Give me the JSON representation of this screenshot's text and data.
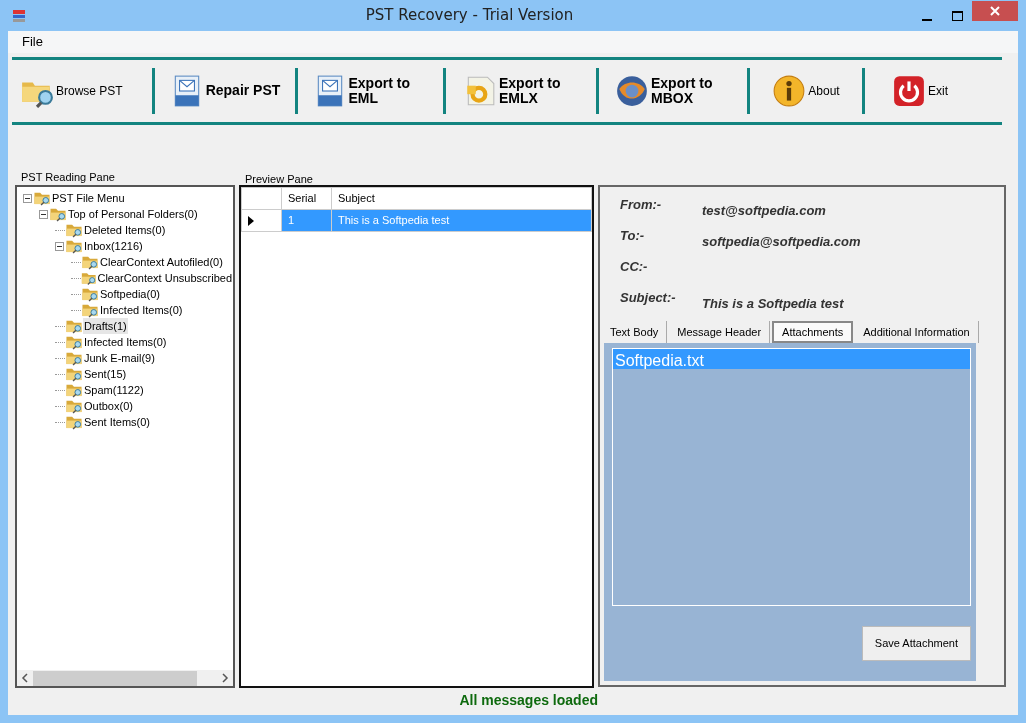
{
  "window": {
    "title": "PST Recovery - Trial Version"
  },
  "menu": [
    "File"
  ],
  "toolbar": [
    {
      "label": "Browse PST",
      "kind": "browse",
      "bold": false
    },
    {
      "label": "Repair PST",
      "kind": "eml",
      "bold": true
    },
    {
      "label": "Export to EML",
      "kind": "eml",
      "bold": true
    },
    {
      "label": "Export to EMLX",
      "kind": "emlx",
      "bold": true
    },
    {
      "label": "Export to MBOX",
      "kind": "mbox",
      "bold": true
    },
    {
      "label": "About",
      "kind": "info",
      "bold": false
    },
    {
      "label": "Exit",
      "kind": "power",
      "bold": false
    }
  ],
  "reading_pane": {
    "title": "PST Reading Pane",
    "tree": [
      {
        "label": "PST File Menu",
        "expanded": true,
        "selected": false,
        "children": [
          {
            "label": "Top of Personal Folders(0)",
            "expanded": true,
            "selected": false,
            "children": [
              {
                "label": "Deleted Items(0)",
                "selected": false
              },
              {
                "label": "Inbox(1216)",
                "expanded": true,
                "selected": false,
                "children": [
                  {
                    "label": "ClearContext Autofiled(0)",
                    "selected": false
                  },
                  {
                    "label": "ClearContext Unsubscribed",
                    "selected": false
                  },
                  {
                    "label": "Softpedia(0)",
                    "selected": false
                  },
                  {
                    "label": "Infected Items(0)",
                    "selected": false
                  }
                ]
              },
              {
                "label": "Drafts(1)",
                "selected": true
              },
              {
                "label": "Infected Items(0)",
                "selected": false
              },
              {
                "label": "Junk E-mail(9)",
                "selected": false
              },
              {
                "label": "Sent(15)",
                "selected": false
              },
              {
                "label": "Spam(1122)",
                "selected": false
              },
              {
                "label": "Outbox(0)",
                "selected": false
              },
              {
                "label": "Sent Items(0)",
                "selected": false
              }
            ]
          }
        ]
      }
    ]
  },
  "preview_pane": {
    "title": "Preview Pane",
    "columns": [
      "Serial",
      "Subject"
    ],
    "rows": [
      {
        "selected": true,
        "cells": [
          "1",
          "This is a Softpedia test"
        ]
      }
    ]
  },
  "message": {
    "fields": [
      {
        "label": "From:-",
        "value": "test@softpedia.com"
      },
      {
        "label": "To:-",
        "value": "softpedia@softpedia.com"
      },
      {
        "label": "CC:-"
      },
      {
        "label": "Subject:-",
        "value": "This is a Softpedia test"
      }
    ],
    "tabs": [
      {
        "label": "Text Body",
        "selected": false
      },
      {
        "label": "Message Header",
        "selected": false
      },
      {
        "label": "Attachments",
        "selected": true
      },
      {
        "label": "Additional Information",
        "selected": false
      }
    ],
    "attachments": [
      {
        "name": "Softpedia.txt",
        "selected": true
      }
    ],
    "save_button": "Save Attachment"
  },
  "status_bar": "All messages loaded"
}
